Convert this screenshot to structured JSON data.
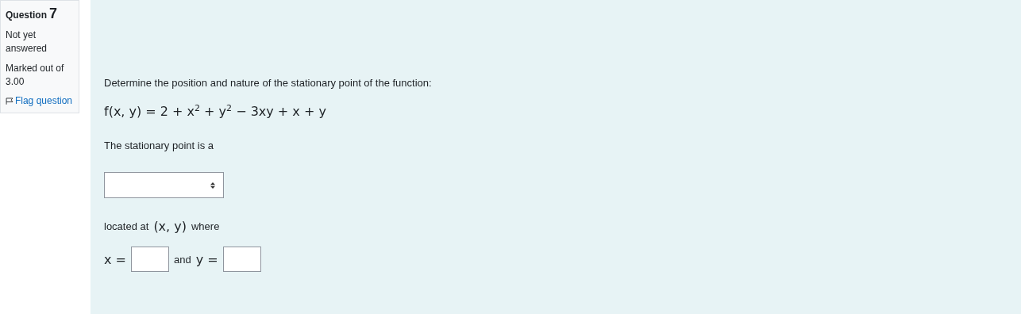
{
  "info": {
    "label": "Question",
    "number": "7",
    "state": "Not yet answered",
    "grade": "Marked out of 3.00",
    "flag_link": "Flag question"
  },
  "question": {
    "prompt": "Determine the position and nature of the stationary point of the function:",
    "formula": "f(x, y) = 2 + x$^{2}$ + y$^{2}$ − 3xy + x + y",
    "lead": "The stationary point is a",
    "located": {
      "before": "located at",
      "math": "(x, y)",
      "after": "where"
    },
    "answers": [
      {
        "label": "x =",
        "kind": "math"
      },
      {
        "label": "and",
        "kind": "text"
      },
      {
        "label": "y =",
        "kind": "math"
      }
    ]
  }
}
